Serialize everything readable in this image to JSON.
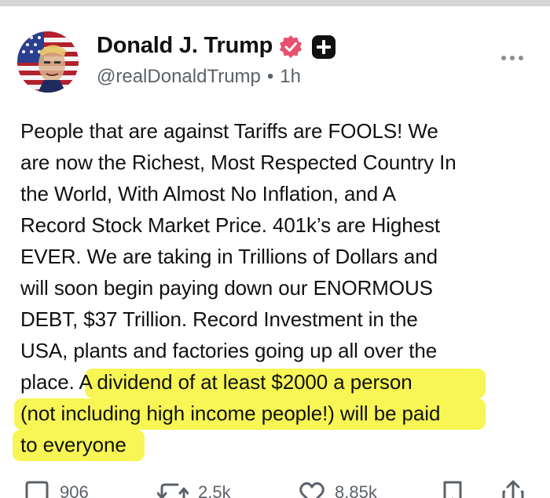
{
  "post": {
    "display_name": "Donald J. Trump",
    "handle": "@realDonaldTrump",
    "separator": "•",
    "time_ago": "1h",
    "avatar_icon": "avatar-flag-portrait",
    "verified_icon": "verified-badge-icon",
    "plus_icon": "plus-badge-icon",
    "more_icon": "more-options-icon",
    "body_lines": [
      "People that are against Tariffs are FOOLS! We",
      "are now the Richest, Most Respected Country In",
      "the World, With Almost No Inflation, and A",
      "Record Stock Market Price. 401k’s are Highest",
      "EVER. We are taking in Trillions of Dollars and",
      "will soon begin paying down our ENORMOUS",
      "DEBT, $37 Trillion. Record Investment in the",
      "USA, plants and factories going up all over the"
    ],
    "line9_plain": "place. ",
    "line9_highlight": "A dividend of at least $2000 a person",
    "line10_highlight": "(not including high income people!) will be paid",
    "line11_highlight": "to everyone",
    "highlight_color": "#f7f54b",
    "verified_color": "#e8506e"
  },
  "actions": {
    "reply": {
      "icon": "reply-icon",
      "count": "906"
    },
    "repost": {
      "icon": "repost-icon",
      "count": "2.5k"
    },
    "like": {
      "icon": "heart-icon",
      "count": "8.85k"
    },
    "bookmark": {
      "icon": "bookmark-icon"
    },
    "share": {
      "icon": "share-icon"
    }
  }
}
